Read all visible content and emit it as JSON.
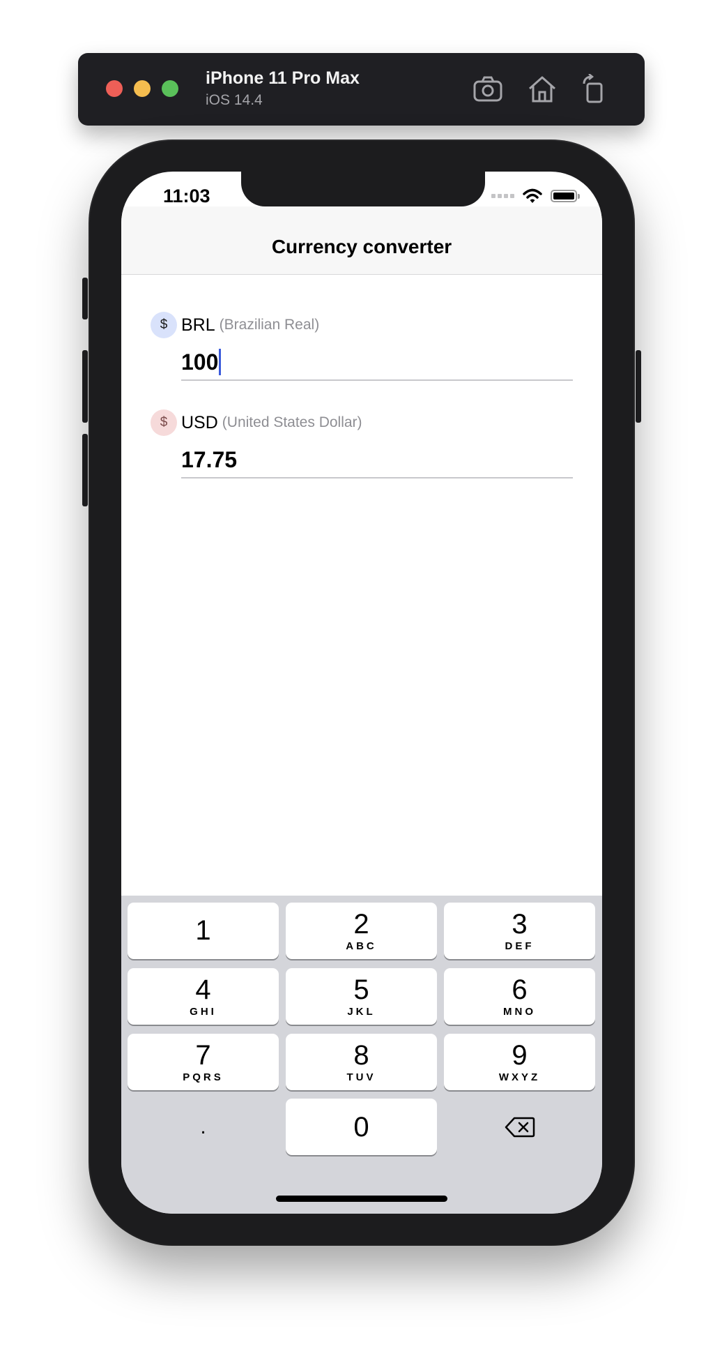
{
  "simulator": {
    "device_name": "iPhone 11 Pro Max",
    "os_version": "iOS 14.4",
    "icons": [
      "screenshot-icon",
      "home-icon",
      "rotate-icon"
    ]
  },
  "status_bar": {
    "time": "11:03",
    "icons": [
      "cellular-icon",
      "wifi-icon",
      "battery-icon"
    ]
  },
  "nav": {
    "title": "Currency converter"
  },
  "currencies": [
    {
      "symbol": "$",
      "code": "BRL",
      "name": "(Brazilian Real)",
      "value": "100",
      "focused": true,
      "badge_color": "#d9e2fb"
    },
    {
      "symbol": "$",
      "code": "USD",
      "name": "(United States Dollar)",
      "value": "17.75",
      "focused": false,
      "badge_color": "#f6dada"
    }
  ],
  "keypad": {
    "keys": [
      {
        "digit": "1",
        "letters": ""
      },
      {
        "digit": "2",
        "letters": "ABC"
      },
      {
        "digit": "3",
        "letters": "DEF"
      },
      {
        "digit": "4",
        "letters": "GHI"
      },
      {
        "digit": "5",
        "letters": "JKL"
      },
      {
        "digit": "6",
        "letters": "MNO"
      },
      {
        "digit": "7",
        "letters": "PQRS"
      },
      {
        "digit": "8",
        "letters": "TUV"
      },
      {
        "digit": "9",
        "letters": "WXYZ"
      },
      {
        "digit": ".",
        "letters": ""
      },
      {
        "digit": "0",
        "letters": ""
      },
      {
        "digit": "",
        "letters": ""
      }
    ],
    "delete_icon": "backspace-icon"
  },
  "colors": {
    "caret": "#3b5bdb",
    "keyboard_bg": "#d4d5da",
    "close": "#ee5f57",
    "minimize": "#f5bd4f",
    "zoom": "#5ac05a"
  }
}
